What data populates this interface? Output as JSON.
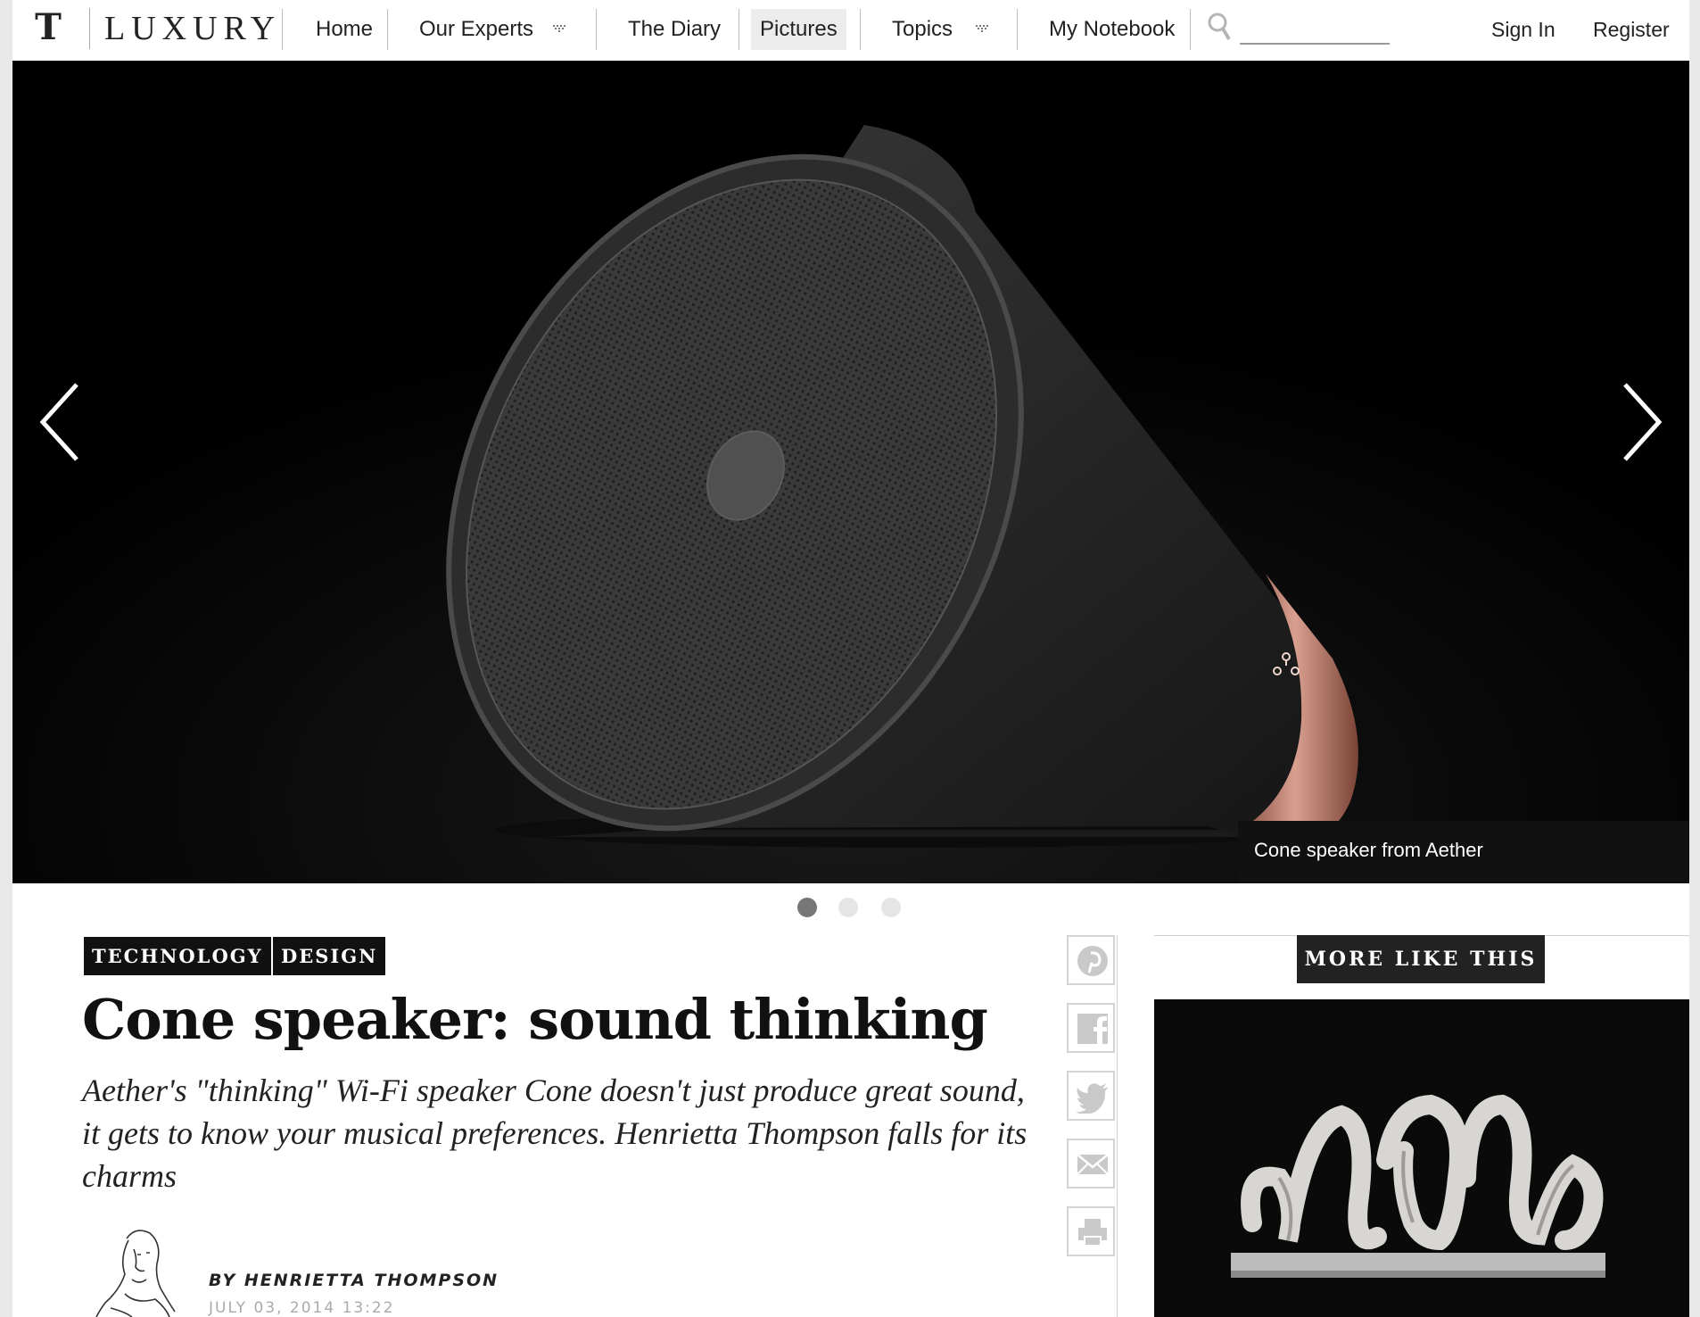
{
  "site": {
    "logo_mark": "T",
    "logo_word": "LUXURY"
  },
  "nav": {
    "items": [
      {
        "label": "Home"
      },
      {
        "label": "Our Experts"
      },
      {
        "label": "The Diary"
      },
      {
        "label": "Pictures"
      },
      {
        "label": "Topics"
      },
      {
        "label": "My Notebook"
      }
    ],
    "active": "Pictures",
    "search_placeholder": "",
    "sign_in": "Sign In",
    "register": "Register"
  },
  "hero": {
    "caption": "Cone speaker from Aether",
    "slide_count": 3,
    "active_slide": 1
  },
  "article": {
    "tags": [
      "TECHNOLOGY",
      "DESIGN"
    ],
    "headline": "Cone speaker: sound thinking",
    "standfirst": "Aether's \"thinking\" Wi-Fi speaker Cone doesn't just produce great sound, it gets to know your musical preferences. Henrietta Thompson falls for its charms",
    "byline": "BY HENRIETTA THOMPSON",
    "date": "JULY 03, 2014 13:22"
  },
  "share": {
    "buttons": [
      "pinterest-icon",
      "facebook-icon",
      "twitter-icon",
      "email-icon",
      "print-icon"
    ]
  },
  "sidebar": {
    "more_label": "MORE LIKE THIS"
  },
  "colors": {
    "accent_dark": "#111111",
    "copper": "#c98f7f",
    "page_bg": "#e9e9e9"
  }
}
